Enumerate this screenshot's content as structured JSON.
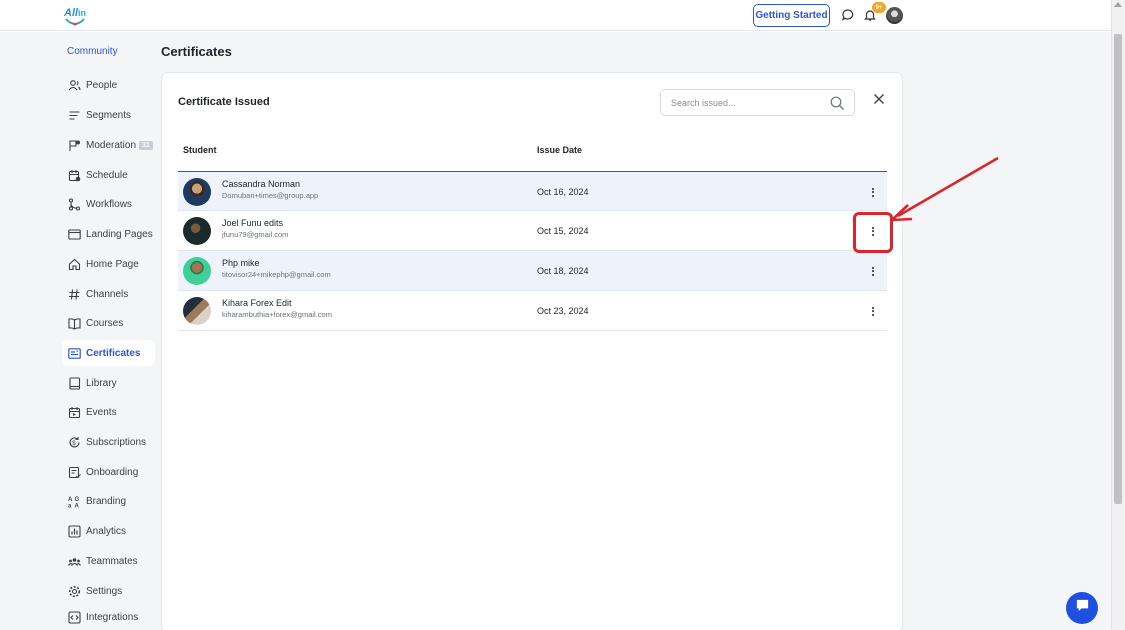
{
  "topbar": {
    "getting_started_label": "Getting Started",
    "notification_count": "9+"
  },
  "sidebar": {
    "heading": "Community",
    "items": [
      {
        "label": "People",
        "icon": "people-icon"
      },
      {
        "label": "Segments",
        "icon": "segments-icon"
      },
      {
        "label": "Moderation",
        "icon": "moderation-icon",
        "badge": "31"
      },
      {
        "label": "Schedule",
        "icon": "schedule-icon"
      },
      {
        "label": "Workflows",
        "icon": "workflows-icon"
      },
      {
        "label": "Landing Pages",
        "icon": "landing-pages-icon"
      },
      {
        "label": "Home Page",
        "icon": "home-icon"
      },
      {
        "label": "Channels",
        "icon": "hashtag-icon"
      },
      {
        "label": "Courses",
        "icon": "book-open-icon"
      },
      {
        "label": "Certificates",
        "icon": "certificate-icon",
        "active": true
      },
      {
        "label": "Library",
        "icon": "library-icon"
      },
      {
        "label": "Events",
        "icon": "events-icon"
      },
      {
        "label": "Subscriptions",
        "icon": "subscriptions-icon"
      },
      {
        "label": "Onboarding",
        "icon": "onboarding-icon"
      },
      {
        "label": "Branding",
        "icon": "branding-icon"
      },
      {
        "label": "Analytics",
        "icon": "analytics-icon"
      },
      {
        "label": "Teammates",
        "icon": "teammates-icon"
      },
      {
        "label": "Settings",
        "icon": "settings-icon"
      },
      {
        "label": "Integrations",
        "icon": "integrations-icon"
      }
    ]
  },
  "page": {
    "title": "Certificates"
  },
  "card": {
    "title": "Certificate Issued",
    "search_placeholder": "Search issued...",
    "columns": {
      "student": "Student",
      "issue_date": "Issue Date"
    },
    "rows": [
      {
        "name": "Cassandra Norman",
        "email": "Domubari+times@group.app",
        "date": "Oct 16, 2024"
      },
      {
        "name": "Joel Funu edits",
        "email": "jfunu79@gmail.com",
        "date": "Oct 15, 2024"
      },
      {
        "name": "Php mike",
        "email": "titovisor24+mikephp@gmail.com",
        "date": "Oct 18, 2024"
      },
      {
        "name": "Kihara Forex Edit",
        "email": "kiharambuthia+forex@gmail.com",
        "date": "Oct 23, 2024"
      }
    ]
  },
  "colors": {
    "accent": "#2f55d4",
    "annotation": "#d9262c",
    "chat": "#1f50e0"
  }
}
